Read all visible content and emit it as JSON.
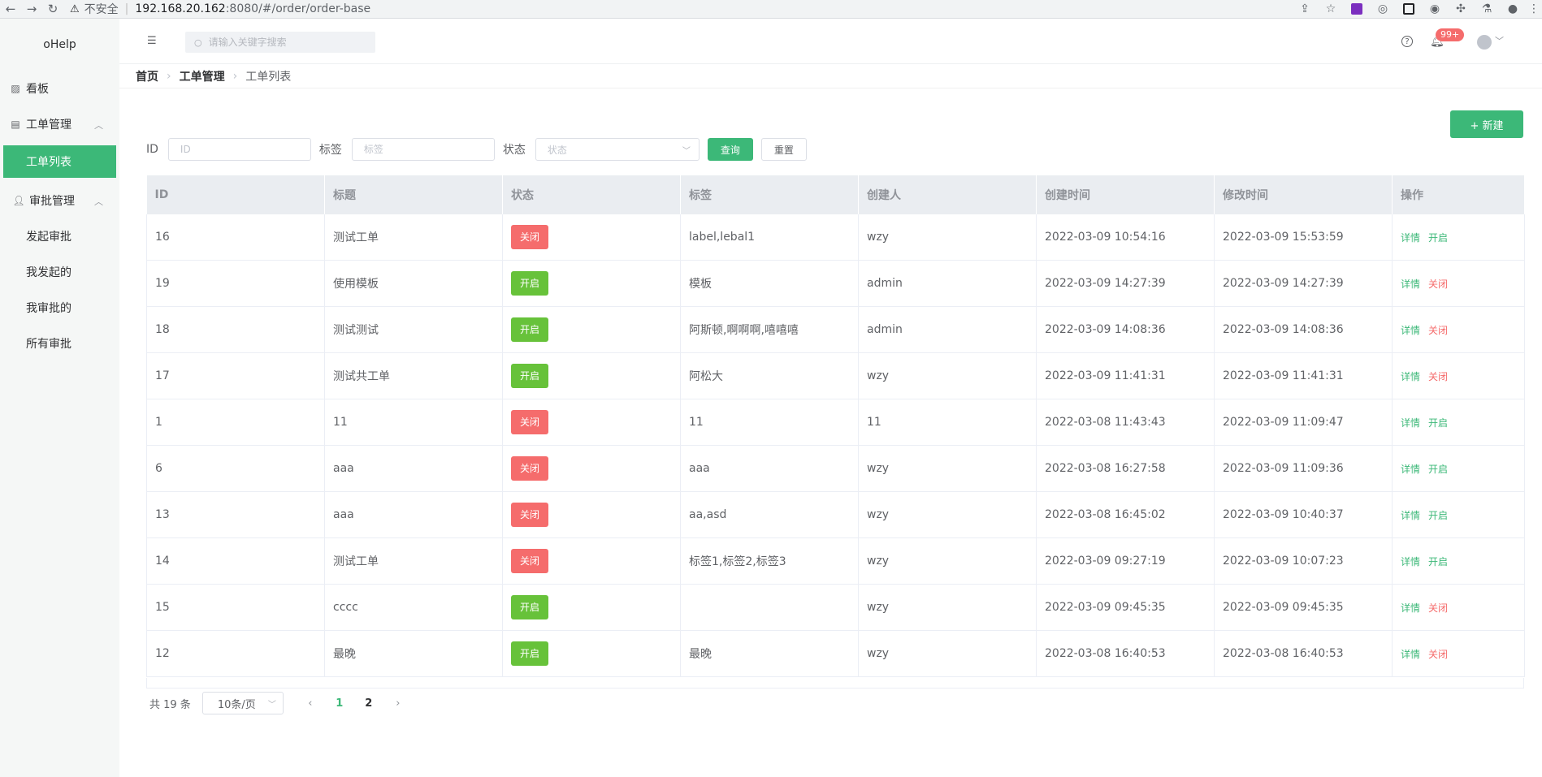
{
  "browser": {
    "back": "←",
    "forward": "→",
    "reload": "↻",
    "insecure_label": "不安全",
    "url_host": "192.168.20.162",
    "url_rest": ":8080/#/order/order-base"
  },
  "sidebar": {
    "logo": "oHelp",
    "items": [
      {
        "label": "看板"
      },
      {
        "label": "工单管理"
      },
      {
        "label": "工单列表"
      },
      {
        "label": "审批管理"
      },
      {
        "label": "发起审批"
      },
      {
        "label": "我发起的"
      },
      {
        "label": "我审批的"
      },
      {
        "label": "所有审批"
      }
    ]
  },
  "header": {
    "search_placeholder": "请输入关键字搜索",
    "notification_count": "99+"
  },
  "breadcrumb": [
    "首页",
    "工单管理",
    "工单列表"
  ],
  "toolbar": {
    "new_label": "+ 新建"
  },
  "filter": {
    "id_label": "ID",
    "id_placeholder": "ID",
    "tag_label": "标签",
    "tag_placeholder": "标签",
    "status_label": "状态",
    "status_placeholder": "状态",
    "query_label": "查询",
    "reset_label": "重置"
  },
  "table": {
    "columns": [
      "ID",
      "标题",
      "状态",
      "标签",
      "创建人",
      "创建时间",
      "修改时间",
      "操作"
    ],
    "detail_label": "详情",
    "rows": [
      {
        "id": "16",
        "title": "测试工单",
        "status": "关闭",
        "status_color": "#f56c6c",
        "tags": "label,lebal1",
        "creator": "wzy",
        "created": "2022-03-09 10:54:16",
        "modified": "2022-03-09 15:53:59",
        "action": "开启",
        "action_color": "#3cb878"
      },
      {
        "id": "19",
        "title": "使用模板",
        "status": "开启",
        "status_color": "#67c23a",
        "tags": "模板",
        "creator": "admin",
        "created": "2022-03-09 14:27:39",
        "modified": "2022-03-09 14:27:39",
        "action": "关闭",
        "action_color": "#f56c6c"
      },
      {
        "id": "18",
        "title": "测试测试",
        "status": "开启",
        "status_color": "#67c23a",
        "tags": "阿斯顿,啊啊啊,嘻嘻嘻",
        "creator": "admin",
        "created": "2022-03-09 14:08:36",
        "modified": "2022-03-09 14:08:36",
        "action": "关闭",
        "action_color": "#f56c6c"
      },
      {
        "id": "17",
        "title": "测试共工单",
        "status": "开启",
        "status_color": "#67c23a",
        "tags": "阿松大",
        "creator": "wzy",
        "created": "2022-03-09 11:41:31",
        "modified": "2022-03-09 11:41:31",
        "action": "关闭",
        "action_color": "#f56c6c"
      },
      {
        "id": "1",
        "title": "11",
        "status": "关闭",
        "status_color": "#f56c6c",
        "tags": "11",
        "creator": "11",
        "created": "2022-03-08 11:43:43",
        "modified": "2022-03-09 11:09:47",
        "action": "开启",
        "action_color": "#3cb878"
      },
      {
        "id": "6",
        "title": "aaa",
        "status": "关闭",
        "status_color": "#f56c6c",
        "tags": "aaa",
        "creator": "wzy",
        "created": "2022-03-08 16:27:58",
        "modified": "2022-03-09 11:09:36",
        "action": "开启",
        "action_color": "#3cb878"
      },
      {
        "id": "13",
        "title": "aaa",
        "status": "关闭",
        "status_color": "#f56c6c",
        "tags": "aa,asd",
        "creator": "wzy",
        "created": "2022-03-08 16:45:02",
        "modified": "2022-03-09 10:40:37",
        "action": "开启",
        "action_color": "#3cb878"
      },
      {
        "id": "14",
        "title": "测试工单",
        "status": "关闭",
        "status_color": "#f56c6c",
        "tags": "标签1,标签2,标签3",
        "creator": "wzy",
        "created": "2022-03-09 09:27:19",
        "modified": "2022-03-09 10:07:23",
        "action": "开启",
        "action_color": "#3cb878"
      },
      {
        "id": "15",
        "title": "cccc",
        "status": "开启",
        "status_color": "#67c23a",
        "tags": "",
        "creator": "wzy",
        "created": "2022-03-09 09:45:35",
        "modified": "2022-03-09 09:45:35",
        "action": "关闭",
        "action_color": "#f56c6c"
      },
      {
        "id": "12",
        "title": "最晚",
        "status": "开启",
        "status_color": "#67c23a",
        "tags": "最晚",
        "creator": "wzy",
        "created": "2022-03-08 16:40:53",
        "modified": "2022-03-08 16:40:53",
        "action": "关闭",
        "action_color": "#f56c6c"
      }
    ]
  },
  "pagination": {
    "total_label": "共 19 条",
    "page_size": "10条/页",
    "prev": "‹",
    "next": "›",
    "pages": [
      "1",
      "2"
    ],
    "current": "1"
  },
  "colors": {
    "accent": "#3cb878",
    "danger": "#f56c6c",
    "success": "#67c23a"
  }
}
